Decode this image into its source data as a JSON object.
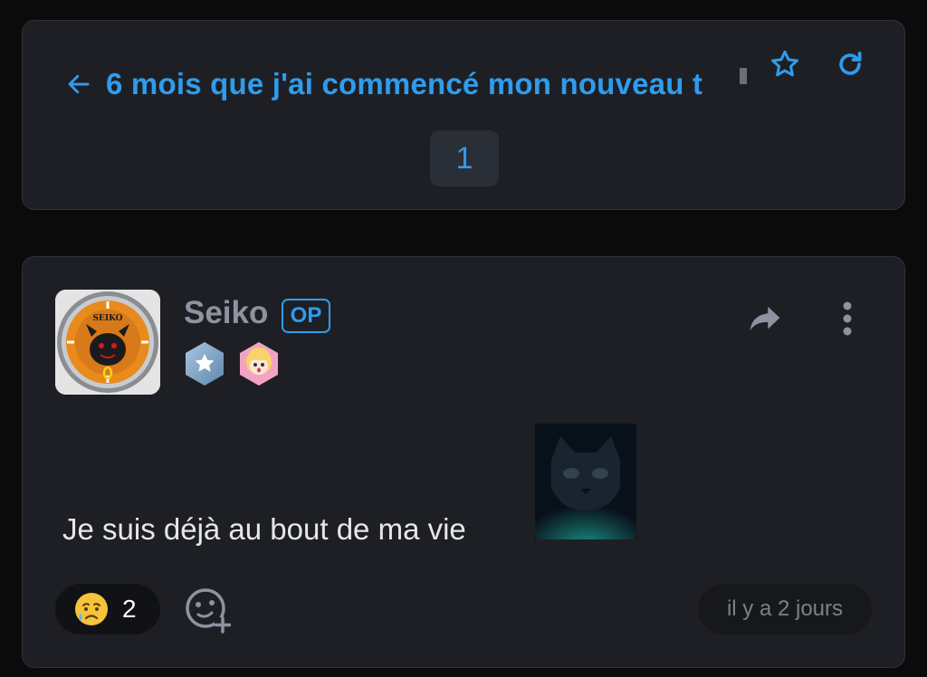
{
  "topic": {
    "title": "6 mois que j'ai commencé mon nouveau t",
    "current_page": "1"
  },
  "post": {
    "author": "Seiko",
    "author_badge": "OP",
    "body": "Je suis déjà au bout de ma vie",
    "reaction": {
      "emoji": "crying-face",
      "count": "2"
    },
    "timestamp": "il y a 2 jours"
  },
  "icons": {
    "back": "arrow-left-icon",
    "favorite": "star-outline-icon",
    "refresh": "refresh-icon",
    "share": "share-arrow-icon",
    "more": "vertical-dots-icon",
    "add_reaction": "add-emoji-icon"
  },
  "colors": {
    "accent": "#2f9cec",
    "card_bg": "#1e1f24",
    "page_bg": "#0b0b0c",
    "muted_text": "#8d93a0"
  }
}
